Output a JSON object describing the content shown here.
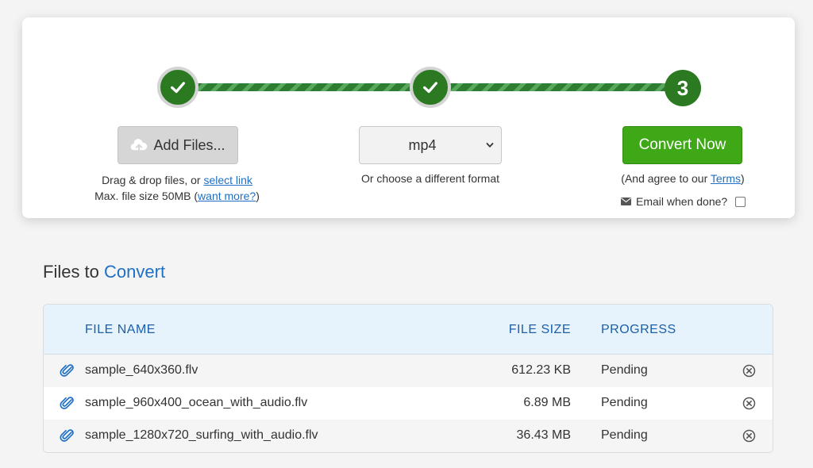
{
  "steps": {
    "step3_number": "3"
  },
  "upload": {
    "add_files_label": "Add Files...",
    "drag_text": "Drag & drop files, or ",
    "select_link": "select link",
    "max_size_text": "Max. file size 50MB (",
    "want_more_link": "want more?",
    "max_size_suffix": ")"
  },
  "format": {
    "selected": "mp4",
    "hint": "Or choose a different format"
  },
  "convert": {
    "button_label": "Convert Now",
    "agree_prefix": "(And agree to our ",
    "terms_link": "Terms",
    "agree_suffix": ")",
    "email_label": "Email when done?",
    "email_checked": false
  },
  "files_section": {
    "title_prefix": "Files to",
    "title_accent": "Convert",
    "columns": {
      "name": "FILE NAME",
      "size": "FILE SIZE",
      "progress": "PROGRESS"
    },
    "rows": [
      {
        "name": "sample_640x360.flv",
        "size": "612.23 KB",
        "progress": "Pending"
      },
      {
        "name": "sample_960x400_ocean_with_audio.flv",
        "size": "6.89 MB",
        "progress": "Pending"
      },
      {
        "name": "sample_1280x720_surfing_with_audio.flv",
        "size": "36.43 MB",
        "progress": "Pending"
      }
    ]
  },
  "colors": {
    "step_green": "#2b7a22",
    "convert_green": "#3fa816",
    "link_blue": "#1e6fc5",
    "header_bg": "#e6f3fc"
  },
  "icons": {
    "step_done": "check-icon",
    "add_files": "cloud-upload-icon",
    "email": "envelope-icon",
    "file": "paperclip-icon",
    "remove": "remove-circle-icon",
    "select": "chevron-down-icon"
  }
}
